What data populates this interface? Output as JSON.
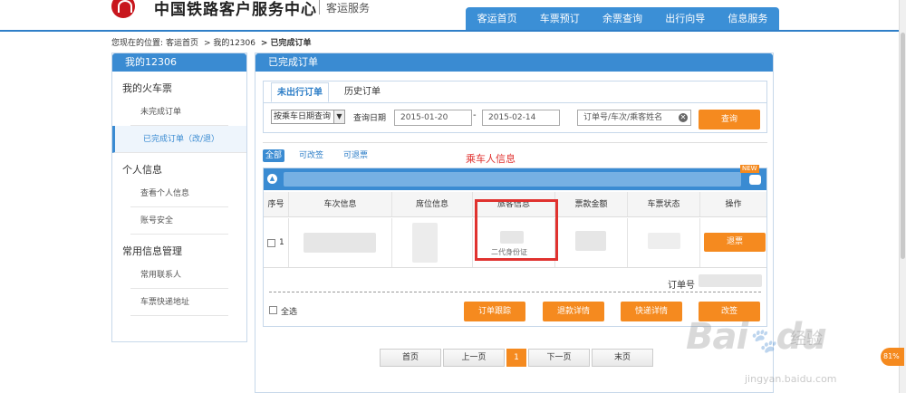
{
  "header": {
    "logo_text": "中国铁路客户服务中心",
    "logo_sub": "客运服务",
    "nav": [
      "客运首页",
      "车票预订",
      "余票查询",
      "出行向导",
      "信息服务"
    ]
  },
  "breadcrumb": {
    "prefix": "您现在的位置:",
    "items": [
      "客运首页",
      "> 我的12306",
      "> 已完成订单"
    ]
  },
  "sidebar": {
    "title": "我的12306",
    "groups": [
      {
        "label": "我的火车票",
        "items": [
          "未完成订单",
          "已完成订单（改/退）"
        ]
      },
      {
        "label": "个人信息",
        "items": [
          "查看个人信息",
          "账号安全"
        ]
      },
      {
        "label": "常用信息管理",
        "items": [
          "常用联系人",
          "车票快递地址"
        ]
      }
    ]
  },
  "main": {
    "title": "已完成订单",
    "tabs": [
      "未出行订单",
      "历史订单"
    ],
    "filter": {
      "select_value": "按乘车日期查询",
      "date_label": "查询日期",
      "date_from": "2015-01-20",
      "date_sep": "-",
      "date_to": "2015-02-14",
      "search_placeholder": "订单号/车次/乘客姓名",
      "query_button": "查询"
    },
    "subtabs": [
      "全部",
      "可改签",
      "可退票"
    ],
    "annotation": "乘车人信息",
    "card": {
      "new_badge": "NEW",
      "columns": [
        "序号",
        "车次信息",
        "席位信息",
        "旅客信息",
        "票款金额",
        "车票状态",
        "操作"
      ],
      "row": {
        "index": "1",
        "passenger_doc": "二代身份证",
        "action": "退票"
      },
      "order_label": "订单号",
      "select_all": "全选",
      "actions": [
        "订单跟踪",
        "退款详情",
        "快递详情",
        "改签"
      ]
    },
    "pager": [
      "首页",
      "上一页",
      "1",
      "下一页",
      "末页"
    ]
  },
  "watermark": {
    "brand": "Bai",
    "brand2": "du",
    "cn": "经验",
    "url": "jingyan.baidu.com"
  },
  "badge": "81%",
  "colors": {
    "primary_blue": "#3a8bd2",
    "orange": "#f58a1f",
    "red_annotation": "#e0322f"
  }
}
